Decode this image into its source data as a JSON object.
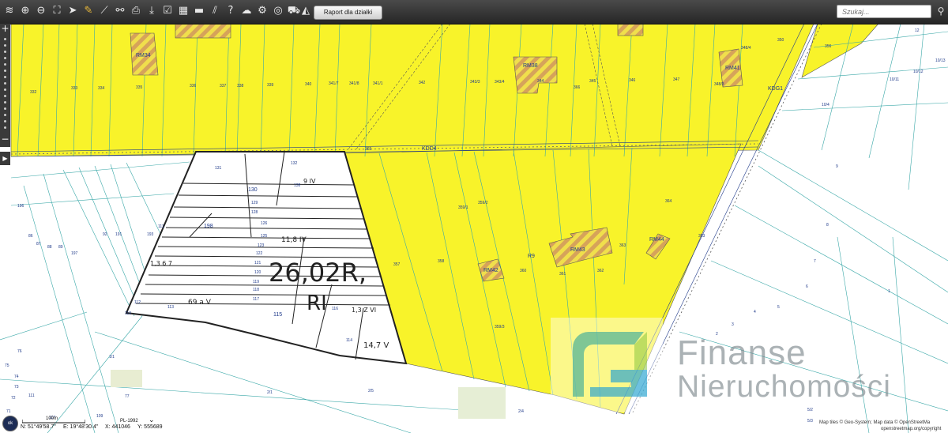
{
  "toolbar": {
    "icons": [
      "layers-icon",
      "zoom-in-icon",
      "zoom-out-icon",
      "zoom-extent-icon",
      "select-arrow-icon",
      "pencil-icon",
      "measure-distance-icon",
      "measure-link-icon",
      "print-icon",
      "download-icon",
      "edit-icon",
      "layout-icon",
      "comment-icon",
      "hatch-icon",
      "help-icon",
      "cloud-upload-icon",
      "settings-icon",
      "zoom-parcel-icon",
      "cart-icon",
      "warning-icon"
    ],
    "report_button": "Raport dla działki",
    "search_placeholder": "Szukaj..."
  },
  "map": {
    "zones": [
      "RM34",
      "RM38",
      "RM41",
      "RM43",
      "RM42",
      "RM44",
      "R9",
      "KDD4",
      "KDG1"
    ],
    "parcels_top": [
      "332",
      "333",
      "334",
      "335",
      "336",
      "337",
      "338",
      "339",
      "340",
      "341/7",
      "341/8",
      "341/1",
      "342",
      "343/3",
      "343/4",
      "344",
      "366",
      "345",
      "346",
      "347",
      "348/3",
      "348/4",
      "350",
      "356",
      "12",
      "10/13",
      "10/11",
      "10/12",
      "10/4",
      "365"
    ],
    "parcels_mid": [
      "131",
      "132",
      "130",
      "138",
      "129",
      "128",
      "126",
      "198",
      "125",
      "123",
      "122",
      "121",
      "120",
      "119",
      "118",
      "117",
      "116",
      "115",
      "114",
      "113",
      "112",
      "111",
      "110",
      "196",
      "86",
      "87",
      "88",
      "89",
      "92",
      "191",
      "193",
      "197",
      "357",
      "358",
      "359/1",
      "359/2",
      "359/3",
      "360",
      "361",
      "362",
      "363",
      "364",
      "353",
      "9",
      "8",
      "7",
      "6",
      "5",
      "4",
      "3",
      "2",
      "1"
    ],
    "parcels_bottom": [
      "76",
      "75",
      "74",
      "73",
      "72",
      "71",
      "111",
      "1/1",
      "77",
      "107",
      "109",
      "2/1",
      "2/5",
      "2/4",
      "5/2",
      "5/3"
    ],
    "handwriting": {
      "main_1": "26,02R,",
      "main_2": "RI",
      "note_1": "11,8 IV",
      "note_2": "69 a V",
      "note_3": "1,3 Z VI",
      "note_4": "14,7 V",
      "note_5": "9 IV",
      "note_6": "1,3 6 7"
    }
  },
  "status": {
    "ok_button": "ok",
    "scale": "100m",
    "crs": "PL-1992",
    "lat": "N: 51°49'58.7\"",
    "lon": "E: 19°48'30.4\"",
    "x": "X: 441046",
    "y": "Y: 555689",
    "attribution": "Map tiles © Geo-System; Map data © OpenStreetMa",
    "attribution_2": "openstreetmap.org/copyright"
  },
  "watermark": {
    "line1": "Finanse",
    "line2": "Nieruchomości",
    "accent_colors": [
      "#4fb39a",
      "#2aa3d0",
      "#8cc63f"
    ]
  },
  "colors": {
    "zone_fill": "#f8f32a",
    "parcel_line": "#3aa8a8",
    "hatch": "#d8a14e",
    "road_line": "#1f3a8a",
    "toolbar": "#2f2f2f"
  }
}
